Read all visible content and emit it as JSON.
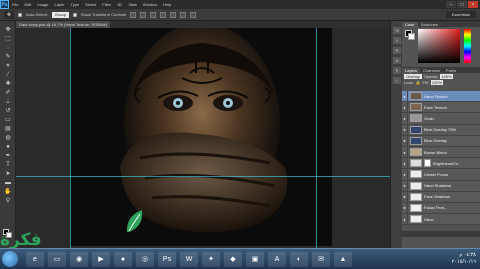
{
  "menubar": {
    "logo": "Ps",
    "items": [
      "File",
      "Edit",
      "Image",
      "Layer",
      "Type",
      "Select",
      "Filter",
      "3D",
      "View",
      "Window",
      "Help"
    ],
    "controls": [
      "minimize-icon",
      "maximize-icon",
      "close-icon"
    ]
  },
  "options": {
    "auto_select_label": "Auto-Select:",
    "auto_select_value": "Group",
    "transform_label": "Show Transform Controls",
    "workspace": "Essentials"
  },
  "document": {
    "tab": "Dark scary.psd @ 16.7% (Hand Texture, RGB/8#)"
  },
  "panels": {
    "color_tabs": [
      "Color",
      "Swatches"
    ],
    "layer_tabs": [
      "Layers",
      "Channels",
      "Paths"
    ],
    "blend_mode": "Overlay",
    "opacity_label": "Opacity:",
    "opacity_value": "100%",
    "lock_label": "Lock:",
    "fill_label": "Fill:",
    "fill_value": "100%",
    "layers": [
      {
        "name": "Hand Texture",
        "selected": true
      },
      {
        "name": "Face Texture",
        "selected": false
      },
      {
        "name": "Grain",
        "selected": false
      },
      {
        "name": "Blue Overlay 79%",
        "selected": false
      },
      {
        "name": "Blue Overlay",
        "selected": false
      },
      {
        "name": "Brown Blend",
        "selected": false
      },
      {
        "name": "Brightness/Co...",
        "selected": false
      },
      {
        "name": "Center Focus",
        "selected": false
      },
      {
        "name": "Hand Shadows",
        "selected": false
      },
      {
        "name": "Face Shadows",
        "selected": false
      },
      {
        "name": "Facial Feat...",
        "selected": false
      },
      {
        "name": "Hand",
        "selected": false
      }
    ]
  },
  "taskbar": {
    "time": "٠٤:٣٨ م",
    "date": "٢٠١٥/١٠/١٦"
  },
  "watermark": "فكرة"
}
